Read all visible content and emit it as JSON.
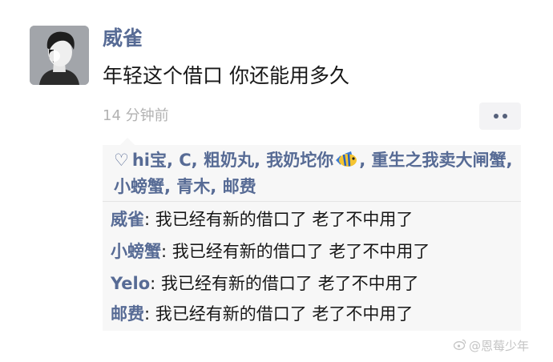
{
  "post": {
    "username": "威雀",
    "text": "年轻这个借口 你还能用多久",
    "timestamp": "14 分钟前"
  },
  "likes": {
    "icon": "heart-outline-icon",
    "names_before_emoji": "hi宝, C, 粗奶丸, 我奶坨你",
    "emoji": "tropical-fish-emoji",
    "names_after_emoji": ", 重生之我卖大闸蟹, 小螃蟹, 青木, 邮费"
  },
  "comments": [
    {
      "author": "威雀",
      "text": ": 我已经有新的借口了 老了不中用了"
    },
    {
      "author": "小螃蟹",
      "text": ": 我已经有新的借口了 老了不中用了"
    },
    {
      "author": "Yelo",
      "text": ": 我已经有新的借口了 老了不中用了"
    },
    {
      "author": "邮费",
      "text": ": 我已经有新的借口了 老了不中用了"
    }
  ],
  "watermark": {
    "text": "@恩莓少年"
  },
  "colors": {
    "link": "#576b95",
    "text": "#181818",
    "meta": "#b2b2b2",
    "box_bg": "#f7f7f7"
  }
}
